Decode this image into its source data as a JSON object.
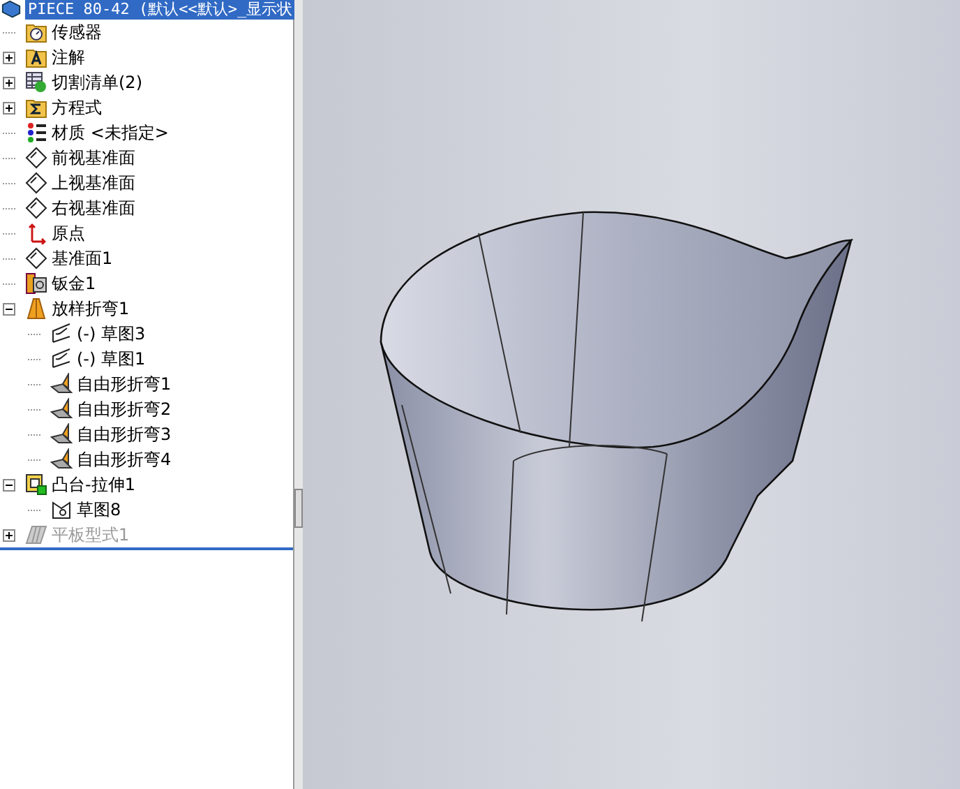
{
  "root": {
    "title": "PIECE 80-42  (默认<<默认>_显示状",
    "selected": true
  },
  "tree": [
    {
      "kind": "sensor",
      "label": "传感器"
    },
    {
      "kind": "annotation",
      "label": "注解",
      "expanded": false
    },
    {
      "kind": "cutlist",
      "label": "切割清单(2)",
      "expanded": false
    },
    {
      "kind": "equation",
      "label": "方程式",
      "expanded": false
    },
    {
      "kind": "material",
      "label": "材质 <未指定>"
    },
    {
      "kind": "plane",
      "label": "前视基准面"
    },
    {
      "kind": "plane",
      "label": "上视基准面"
    },
    {
      "kind": "plane",
      "label": "右视基准面"
    },
    {
      "kind": "origin",
      "label": "原点"
    },
    {
      "kind": "plane",
      "label": "基准面1"
    },
    {
      "kind": "sheetmetal",
      "label": "钣金1"
    },
    {
      "kind": "loft",
      "label": "放样折弯1",
      "expanded": true,
      "children": [
        {
          "kind": "sketch",
          "label": "(-) 草图3"
        },
        {
          "kind": "sketch",
          "label": "(-) 草图1"
        },
        {
          "kind": "bend",
          "label": "自由形折弯1"
        },
        {
          "kind": "bend",
          "label": "自由形折弯2"
        },
        {
          "kind": "bend",
          "label": "自由形折弯3"
        },
        {
          "kind": "bend",
          "label": "自由形折弯4"
        }
      ]
    },
    {
      "kind": "extrude",
      "label": "凸台-拉伸1",
      "expanded": true,
      "children": [
        {
          "kind": "sketch2",
          "label": "草图8"
        }
      ]
    },
    {
      "kind": "flat",
      "label": "平板型式1",
      "expanded": false,
      "disabled": true
    }
  ]
}
